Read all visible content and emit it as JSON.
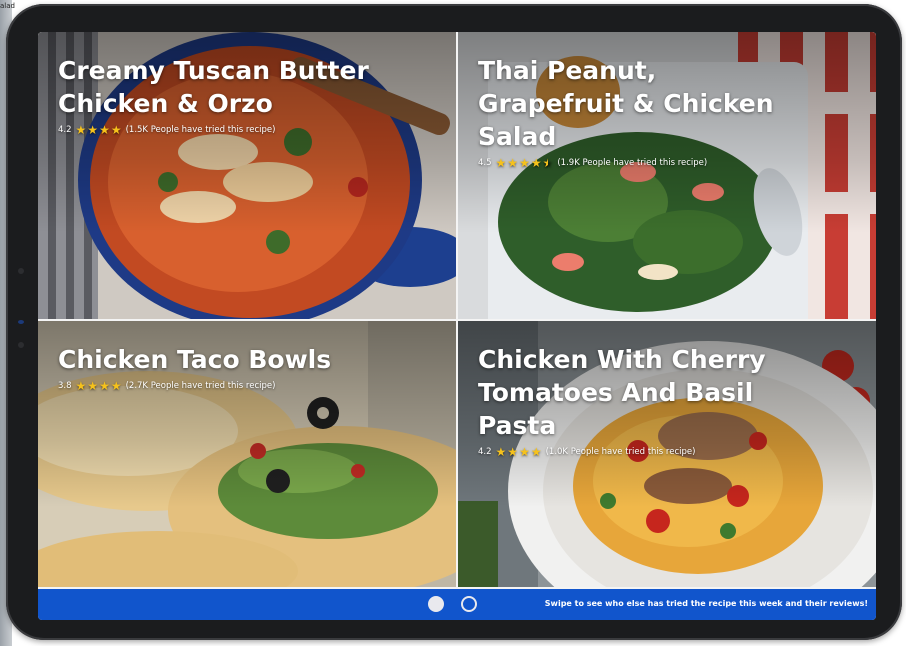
{
  "edge_text": "alad",
  "recipes": [
    {
      "title_lines": [
        "Creamy Tuscan Butter",
        "Chicken & Orzo"
      ],
      "rating": "4.2",
      "stars": 4,
      "tried": "(1.5K People have tried this recipe)"
    },
    {
      "title_lines": [
        "Thai Peanut,",
        "Grapefruit & Chicken",
        "Salad"
      ],
      "rating": "4.5",
      "stars": 4.5,
      "tried": "(1.9K People have tried this recipe)"
    },
    {
      "title_lines": [
        "Chicken Taco Bowls"
      ],
      "rating": "3.8",
      "stars": 4,
      "tried": "(2.7K People have tried this recipe)"
    },
    {
      "title_lines": [
        "Chicken With Cherry",
        "Tomatoes And Basil",
        "Pasta"
      ],
      "rating": "4.2",
      "stars": 4,
      "tried": "(1.0K People have tried this recipe)"
    }
  ],
  "footer": {
    "message": "Swipe to see who else has tried the recipe this week and their reviews!",
    "page_count": 2,
    "active_page": 1
  },
  "colors": {
    "accent": "#1155cc",
    "star": "#f6c21c",
    "bezel": "#1b1c1e"
  },
  "icons": [
    "star-icon",
    "half-star-icon",
    "page-dot-icon"
  ]
}
